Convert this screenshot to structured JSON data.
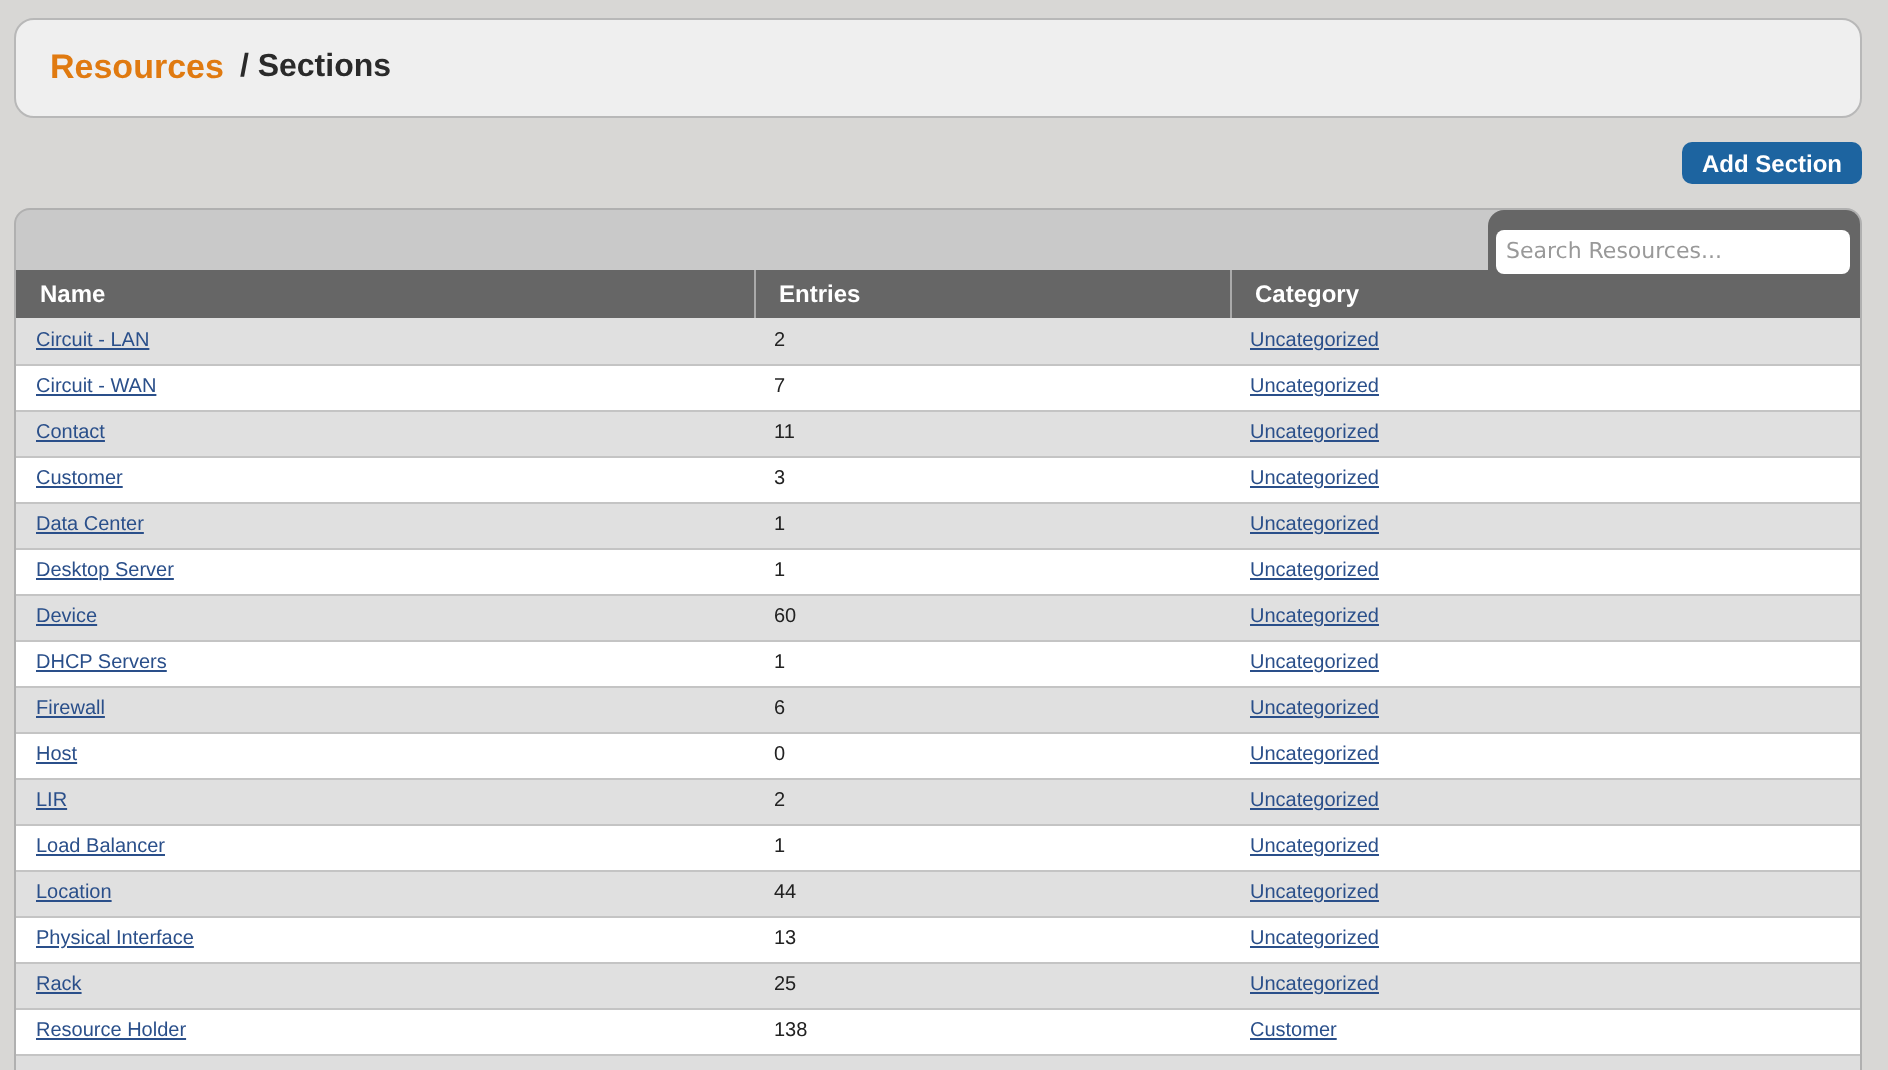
{
  "breadcrumb": {
    "parent": "Resources",
    "separator": "/",
    "current": "Sections"
  },
  "add_button": "Add Section",
  "search": {
    "placeholder": "Search Resources..."
  },
  "table": {
    "columns": [
      "Name",
      "Entries",
      "Category"
    ],
    "rows": [
      {
        "name": "Circuit - LAN",
        "entries": "2",
        "category": "Uncategorized"
      },
      {
        "name": "Circuit - WAN",
        "entries": "7",
        "category": "Uncategorized"
      },
      {
        "name": "Contact",
        "entries": "11",
        "category": "Uncategorized"
      },
      {
        "name": "Customer",
        "entries": "3",
        "category": "Uncategorized"
      },
      {
        "name": "Data Center",
        "entries": "1",
        "category": "Uncategorized"
      },
      {
        "name": "Desktop Server",
        "entries": "1",
        "category": "Uncategorized"
      },
      {
        "name": "Device",
        "entries": "60",
        "category": "Uncategorized"
      },
      {
        "name": "DHCP Servers",
        "entries": "1",
        "category": "Uncategorized"
      },
      {
        "name": "Firewall",
        "entries": "6",
        "category": "Uncategorized"
      },
      {
        "name": "Host",
        "entries": "0",
        "category": "Uncategorized"
      },
      {
        "name": "LIR",
        "entries": "2",
        "category": "Uncategorized"
      },
      {
        "name": "Load Balancer",
        "entries": "1",
        "category": "Uncategorized"
      },
      {
        "name": "Location",
        "entries": "44",
        "category": "Uncategorized"
      },
      {
        "name": "Physical Interface",
        "entries": "13",
        "category": "Uncategorized"
      },
      {
        "name": "Rack",
        "entries": "25",
        "category": "Uncategorized"
      },
      {
        "name": "Resource Holder",
        "entries": "138",
        "category": "Customer"
      }
    ]
  }
}
